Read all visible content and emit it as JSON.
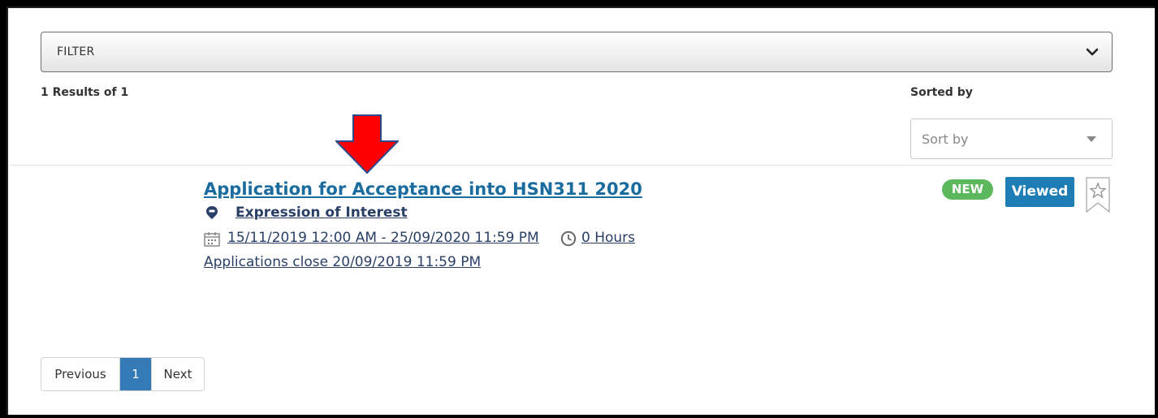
{
  "filter": {
    "label": "FILTER",
    "icon": "chevron-down-icon"
  },
  "results": {
    "summary": "1 Results of 1"
  },
  "sort": {
    "label": "Sorted by",
    "placeholder": "Sort by"
  },
  "annotation": {
    "icon": "red-down-arrow-icon",
    "color": "#ff0000"
  },
  "item": {
    "title": "Application for Acceptance into HSN311 2020",
    "type": "Expression of Interest",
    "type_icon": "map-pin-icon",
    "date_range": "15/11/2019 12:00 AM - 25/09/2020 11:59 PM",
    "date_icon": "calendar-icon",
    "hours": "0 Hours",
    "hours_icon": "clock-icon",
    "applications_close": "Applications close 20/09/2019 11:59 PM",
    "badge": "NEW",
    "viewed_label": "Viewed",
    "bookmark_icon": "star-bookmark-icon"
  },
  "pagination": {
    "previous": "Previous",
    "current": "1",
    "next": "Next"
  },
  "colors": {
    "link": "#1a6c9e",
    "badge_new": "#5cb85c",
    "viewed_button": "#1d7db4",
    "pager_active": "#337ab7"
  }
}
